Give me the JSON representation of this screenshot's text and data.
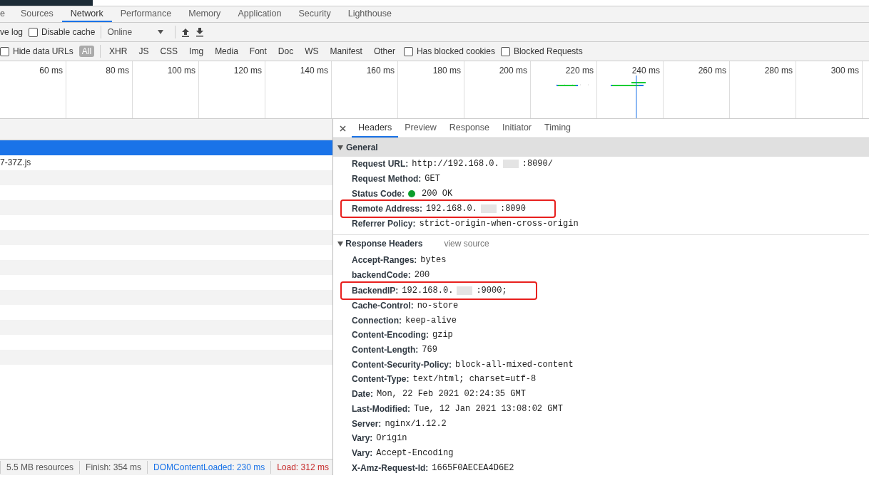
{
  "panel_tabs": [
    {
      "label": "e",
      "selected": false
    },
    {
      "label": "Sources",
      "selected": false
    },
    {
      "label": "Network",
      "selected": true
    },
    {
      "label": "Performance",
      "selected": false
    },
    {
      "label": "Memory",
      "selected": false
    },
    {
      "label": "Application",
      "selected": false
    },
    {
      "label": "Security",
      "selected": false
    },
    {
      "label": "Lighthouse",
      "selected": false
    }
  ],
  "toolbar": {
    "items": [
      {
        "kind": "text",
        "label": "ve log"
      },
      {
        "kind": "checkbox",
        "label": "Disable cache",
        "checked": false
      },
      {
        "kind": "divider"
      },
      {
        "kind": "select",
        "label": "Online"
      },
      {
        "kind": "divider"
      },
      {
        "kind": "upload"
      },
      {
        "kind": "download"
      }
    ]
  },
  "filter_bar": {
    "items": [
      {
        "kind": "checkbox",
        "label": "Hide data URLs",
        "checked": false
      },
      {
        "kind": "type",
        "label": "All",
        "selected": true
      },
      {
        "kind": "divider"
      },
      {
        "kind": "type",
        "label": "XHR",
        "selected": false
      },
      {
        "kind": "type",
        "label": "JS",
        "selected": false
      },
      {
        "kind": "type",
        "label": "CSS",
        "selected": false
      },
      {
        "kind": "type",
        "label": "Img",
        "selected": false
      },
      {
        "kind": "type",
        "label": "Media",
        "selected": false
      },
      {
        "kind": "type",
        "label": "Font",
        "selected": false
      },
      {
        "kind": "type",
        "label": "Doc",
        "selected": false
      },
      {
        "kind": "type",
        "label": "WS",
        "selected": false
      },
      {
        "kind": "type",
        "label": "Manifest",
        "selected": false
      },
      {
        "kind": "type",
        "label": "Other",
        "selected": false
      },
      {
        "kind": "checkbox",
        "label": "Has blocked cookies",
        "checked": false
      },
      {
        "kind": "checkbox",
        "label": "Blocked Requests",
        "checked": false
      }
    ]
  },
  "overview": {
    "ticks": [
      "60 ms",
      "80 ms",
      "100 ms",
      "120 ms",
      "140 ms",
      "160 ms",
      "180 ms",
      "200 ms",
      "220 ms",
      "240 ms",
      "260 ms",
      "280 ms",
      "300 ms"
    ]
  },
  "requests": [
    {
      "selected": true
    },
    {
      "name": "7-37Z.js",
      "selected": false
    }
  ],
  "summary": [
    {
      "text": "5.5 MB resources",
      "kind": "plain"
    },
    {
      "text": "Finish: 354 ms",
      "kind": "plain"
    },
    {
      "text": "DOMContentLoaded: 230 ms",
      "kind": "dom"
    },
    {
      "text": "Load: 312 ms",
      "kind": "load"
    }
  ],
  "detail_tabs": [
    {
      "label": "Headers",
      "selected": true
    },
    {
      "label": "Preview",
      "selected": false
    },
    {
      "label": "Response",
      "selected": false
    },
    {
      "label": "Initiator",
      "selected": false
    },
    {
      "label": "Timing",
      "selected": false
    }
  ],
  "general": {
    "title": "General",
    "expanded": true,
    "rows": [
      {
        "name": "Request URL:",
        "value": "http://192.168.0.",
        "redacted": true,
        "value_after": ":8090/"
      },
      {
        "name": "Request Method:",
        "value": "GET"
      },
      {
        "name": "Status Code:",
        "value": "200 OK",
        "status": true
      },
      {
        "name": "Remote Address:",
        "value": "192.168.0.",
        "redacted": true,
        "value_after": ":8090",
        "highlighted": true
      },
      {
        "name": "Referrer Policy:",
        "value": "strict-origin-when-cross-origin"
      }
    ]
  },
  "response_headers": {
    "title": "Response Headers",
    "expanded": true,
    "link": "view source",
    "rows": [
      {
        "name": "Accept-Ranges:",
        "value": "bytes"
      },
      {
        "name": "backendCode:",
        "value": "200"
      },
      {
        "name": "BackendIP:",
        "value": "192.168.0.",
        "redacted": true,
        "value_after": ":9000;",
        "highlighted": true
      },
      {
        "name": "Cache-Control:",
        "value": "no-store"
      },
      {
        "name": "Connection:",
        "value": "keep-alive"
      },
      {
        "name": "Content-Encoding:",
        "value": "gzip"
      },
      {
        "name": "Content-Length:",
        "value": "769"
      },
      {
        "name": "Content-Security-Policy:",
        "value": "block-all-mixed-content"
      },
      {
        "name": "Content-Type:",
        "value": "text/html; charset=utf-8"
      },
      {
        "name": "Date:",
        "value": "Mon, 22 Feb 2021 02:24:35 GMT"
      },
      {
        "name": "Last-Modified:",
        "value": "Tue, 12 Jan 2021 13:08:02 GMT"
      },
      {
        "name": "Server:",
        "value": "nginx/1.12.2"
      },
      {
        "name": "Vary:",
        "value": "Origin"
      },
      {
        "name": "Vary:",
        "value": "Accept-Encoding"
      },
      {
        "name": "X-Amz-Request-Id:",
        "value": "1665F0AECEA4D6E2"
      }
    ]
  }
}
